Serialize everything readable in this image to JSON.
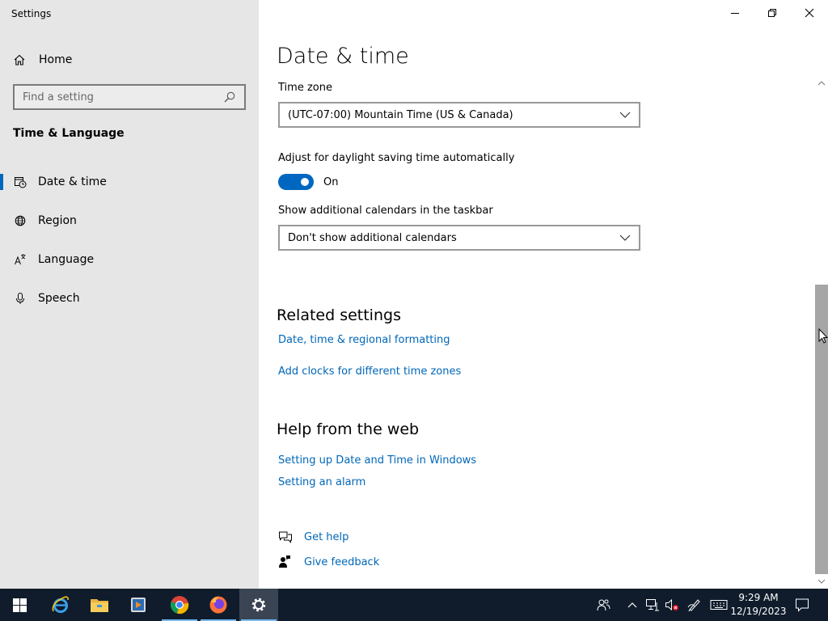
{
  "window": {
    "title": "Settings"
  },
  "sidebar": {
    "home_label": "Home",
    "search_placeholder": "Find a setting",
    "category": "Time & Language",
    "items": [
      {
        "label": "Date & time",
        "icon": "date-time-icon",
        "active": true
      },
      {
        "label": "Region",
        "icon": "globe-icon"
      },
      {
        "label": "Language",
        "icon": "language-icon"
      },
      {
        "label": "Speech",
        "icon": "microphone-icon"
      }
    ]
  },
  "main": {
    "title": "Date & time",
    "time_zone": {
      "label": "Time zone",
      "value": "(UTC-07:00) Mountain Time (US & Canada)"
    },
    "daylight": {
      "label": "Adjust for daylight saving time automatically",
      "state": "On"
    },
    "calendars": {
      "label": "Show additional calendars in the taskbar",
      "value": "Don't show additional calendars"
    },
    "related": {
      "title": "Related settings",
      "links": [
        "Date, time & regional formatting",
        "Add clocks for different time zones"
      ]
    },
    "help": {
      "title": "Help from the web",
      "links": [
        "Setting up Date and Time in Windows",
        "Setting an alarm"
      ]
    },
    "get_help": "Get help",
    "give_feedback": "Give feedback"
  },
  "taskbar": {
    "apps": [
      "start",
      "internet-explorer",
      "file-explorer",
      "media-player",
      "chrome",
      "firefox",
      "settings"
    ],
    "time": "9:29 AM",
    "date": "12/19/2023"
  },
  "colors": {
    "accent": "#0067c0",
    "link": "#0067b8",
    "sidebar_bg": "#e6e6e6",
    "taskbar_bg": "#101c2c"
  }
}
